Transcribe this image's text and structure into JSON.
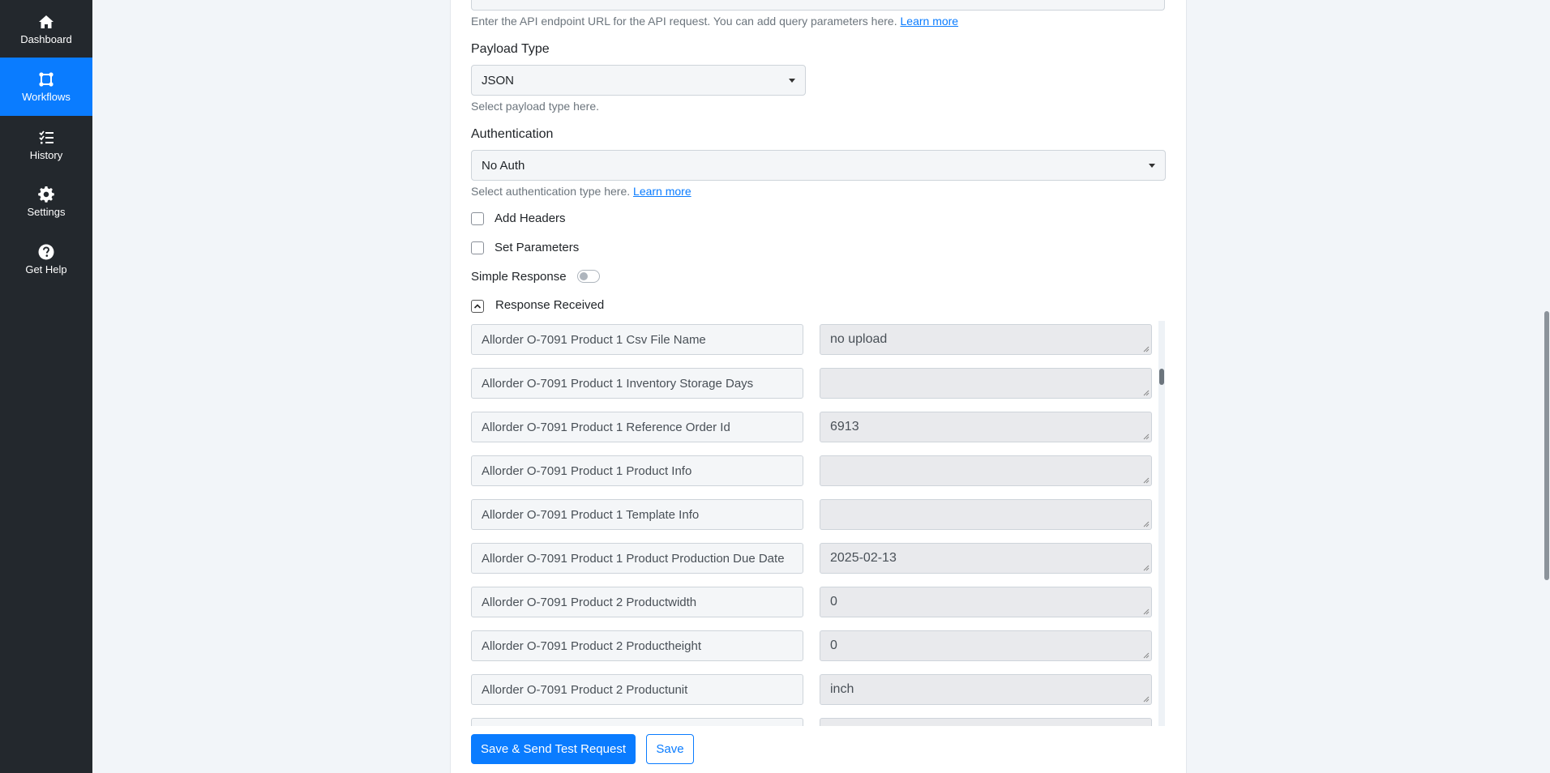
{
  "sidebar": {
    "items": [
      {
        "label": "Dashboard",
        "icon": "home-icon",
        "active": false
      },
      {
        "label": "Workflows",
        "icon": "workflow-icon",
        "active": true
      },
      {
        "label": "History",
        "icon": "list-icon",
        "active": false
      },
      {
        "label": "Settings",
        "icon": "gear-icon",
        "active": false
      },
      {
        "label": "Get Help",
        "icon": "question-circle-icon",
        "active": false
      }
    ]
  },
  "form": {
    "url_help": "Enter the API endpoint URL for the API request. You can add query parameters here.",
    "url_help_link": "Learn more",
    "payload_type": {
      "label": "Payload Type",
      "value": "JSON",
      "help": "Select payload type here."
    },
    "authentication": {
      "label": "Authentication",
      "value": "No Auth",
      "help": "Select authentication type here.",
      "help_link": "Learn more"
    },
    "add_headers_label": "Add Headers",
    "set_parameters_label": "Set Parameters",
    "simple_response_label": "Simple Response",
    "response_received_label": "Response Received"
  },
  "response_rows": [
    {
      "key": "Allorder O-7091 Product 1 Csv File Name",
      "value": "no upload"
    },
    {
      "key": "Allorder O-7091 Product 1 Inventory Storage Days",
      "value": ""
    },
    {
      "key": "Allorder O-7091 Product 1 Reference Order Id",
      "value": "6913"
    },
    {
      "key": "Allorder O-7091 Product 1 Product Info",
      "value": ""
    },
    {
      "key": "Allorder O-7091 Product 1 Template Info",
      "value": ""
    },
    {
      "key": "Allorder O-7091 Product 1 Product Production Due Date",
      "value": "2025-02-13"
    },
    {
      "key": "Allorder O-7091 Product 2 Productwidth",
      "value": "0"
    },
    {
      "key": "Allorder O-7091 Product 2 Productheight",
      "value": "0"
    },
    {
      "key": "Allorder O-7091 Product 2 Productunit",
      "value": "inch"
    },
    {
      "key": "",
      "value": ""
    }
  ],
  "actions": {
    "save_send_label": "Save & Send Test Request",
    "save_label": "Save"
  },
  "colors": {
    "sidebar_bg": "#23282d",
    "accent": "#0a7cff"
  }
}
